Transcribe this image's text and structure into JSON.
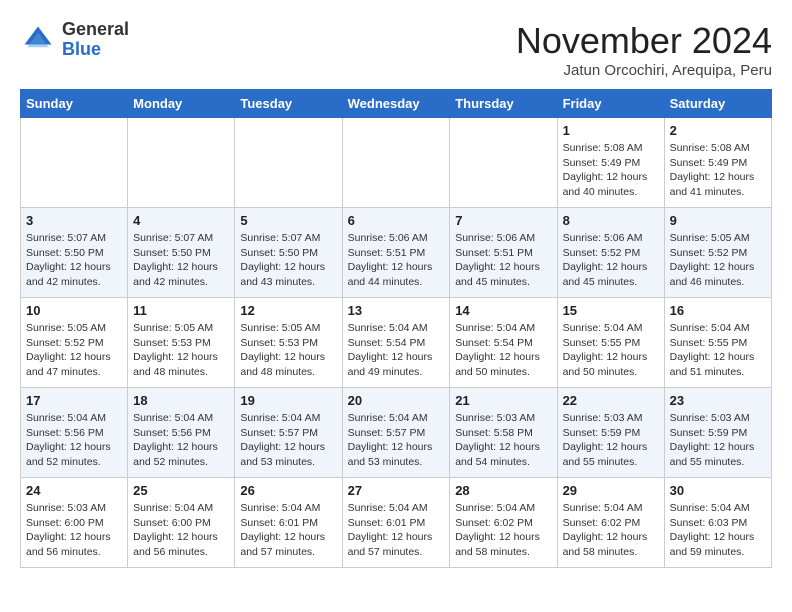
{
  "header": {
    "logo_general": "General",
    "logo_blue": "Blue",
    "month_title": "November 2024",
    "subtitle": "Jatun Orcochiri, Arequipa, Peru"
  },
  "weekdays": [
    "Sunday",
    "Monday",
    "Tuesday",
    "Wednesday",
    "Thursday",
    "Friday",
    "Saturday"
  ],
  "weeks": [
    [
      {
        "day": "",
        "info": ""
      },
      {
        "day": "",
        "info": ""
      },
      {
        "day": "",
        "info": ""
      },
      {
        "day": "",
        "info": ""
      },
      {
        "day": "",
        "info": ""
      },
      {
        "day": "1",
        "info": "Sunrise: 5:08 AM\nSunset: 5:49 PM\nDaylight: 12 hours\nand 40 minutes."
      },
      {
        "day": "2",
        "info": "Sunrise: 5:08 AM\nSunset: 5:49 PM\nDaylight: 12 hours\nand 41 minutes."
      }
    ],
    [
      {
        "day": "3",
        "info": "Sunrise: 5:07 AM\nSunset: 5:50 PM\nDaylight: 12 hours\nand 42 minutes."
      },
      {
        "day": "4",
        "info": "Sunrise: 5:07 AM\nSunset: 5:50 PM\nDaylight: 12 hours\nand 42 minutes."
      },
      {
        "day": "5",
        "info": "Sunrise: 5:07 AM\nSunset: 5:50 PM\nDaylight: 12 hours\nand 43 minutes."
      },
      {
        "day": "6",
        "info": "Sunrise: 5:06 AM\nSunset: 5:51 PM\nDaylight: 12 hours\nand 44 minutes."
      },
      {
        "day": "7",
        "info": "Sunrise: 5:06 AM\nSunset: 5:51 PM\nDaylight: 12 hours\nand 45 minutes."
      },
      {
        "day": "8",
        "info": "Sunrise: 5:06 AM\nSunset: 5:52 PM\nDaylight: 12 hours\nand 45 minutes."
      },
      {
        "day": "9",
        "info": "Sunrise: 5:05 AM\nSunset: 5:52 PM\nDaylight: 12 hours\nand 46 minutes."
      }
    ],
    [
      {
        "day": "10",
        "info": "Sunrise: 5:05 AM\nSunset: 5:52 PM\nDaylight: 12 hours\nand 47 minutes."
      },
      {
        "day": "11",
        "info": "Sunrise: 5:05 AM\nSunset: 5:53 PM\nDaylight: 12 hours\nand 48 minutes."
      },
      {
        "day": "12",
        "info": "Sunrise: 5:05 AM\nSunset: 5:53 PM\nDaylight: 12 hours\nand 48 minutes."
      },
      {
        "day": "13",
        "info": "Sunrise: 5:04 AM\nSunset: 5:54 PM\nDaylight: 12 hours\nand 49 minutes."
      },
      {
        "day": "14",
        "info": "Sunrise: 5:04 AM\nSunset: 5:54 PM\nDaylight: 12 hours\nand 50 minutes."
      },
      {
        "day": "15",
        "info": "Sunrise: 5:04 AM\nSunset: 5:55 PM\nDaylight: 12 hours\nand 50 minutes."
      },
      {
        "day": "16",
        "info": "Sunrise: 5:04 AM\nSunset: 5:55 PM\nDaylight: 12 hours\nand 51 minutes."
      }
    ],
    [
      {
        "day": "17",
        "info": "Sunrise: 5:04 AM\nSunset: 5:56 PM\nDaylight: 12 hours\nand 52 minutes."
      },
      {
        "day": "18",
        "info": "Sunrise: 5:04 AM\nSunset: 5:56 PM\nDaylight: 12 hours\nand 52 minutes."
      },
      {
        "day": "19",
        "info": "Sunrise: 5:04 AM\nSunset: 5:57 PM\nDaylight: 12 hours\nand 53 minutes."
      },
      {
        "day": "20",
        "info": "Sunrise: 5:04 AM\nSunset: 5:57 PM\nDaylight: 12 hours\nand 53 minutes."
      },
      {
        "day": "21",
        "info": "Sunrise: 5:03 AM\nSunset: 5:58 PM\nDaylight: 12 hours\nand 54 minutes."
      },
      {
        "day": "22",
        "info": "Sunrise: 5:03 AM\nSunset: 5:59 PM\nDaylight: 12 hours\nand 55 minutes."
      },
      {
        "day": "23",
        "info": "Sunrise: 5:03 AM\nSunset: 5:59 PM\nDaylight: 12 hours\nand 55 minutes."
      }
    ],
    [
      {
        "day": "24",
        "info": "Sunrise: 5:03 AM\nSunset: 6:00 PM\nDaylight: 12 hours\nand 56 minutes."
      },
      {
        "day": "25",
        "info": "Sunrise: 5:04 AM\nSunset: 6:00 PM\nDaylight: 12 hours\nand 56 minutes."
      },
      {
        "day": "26",
        "info": "Sunrise: 5:04 AM\nSunset: 6:01 PM\nDaylight: 12 hours\nand 57 minutes."
      },
      {
        "day": "27",
        "info": "Sunrise: 5:04 AM\nSunset: 6:01 PM\nDaylight: 12 hours\nand 57 minutes."
      },
      {
        "day": "28",
        "info": "Sunrise: 5:04 AM\nSunset: 6:02 PM\nDaylight: 12 hours\nand 58 minutes."
      },
      {
        "day": "29",
        "info": "Sunrise: 5:04 AM\nSunset: 6:02 PM\nDaylight: 12 hours\nand 58 minutes."
      },
      {
        "day": "30",
        "info": "Sunrise: 5:04 AM\nSunset: 6:03 PM\nDaylight: 12 hours\nand 59 minutes."
      }
    ]
  ]
}
